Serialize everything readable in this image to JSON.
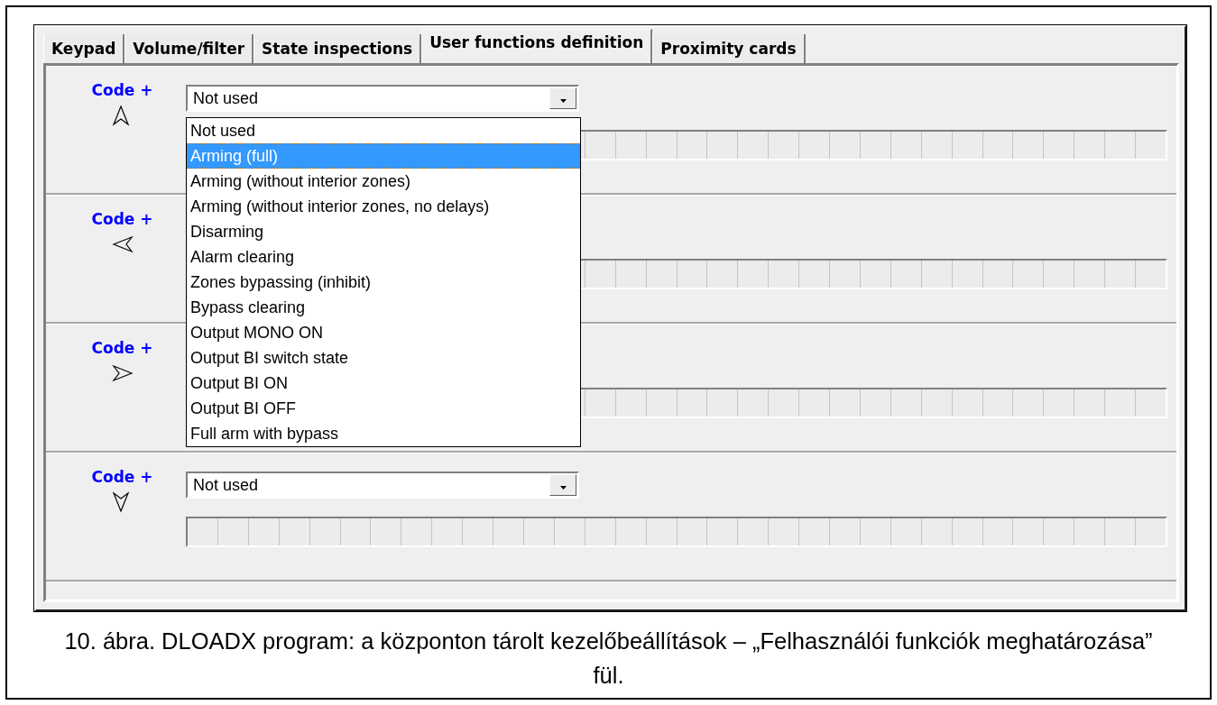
{
  "tabs": [
    {
      "label": "Keypad",
      "selected": false
    },
    {
      "label": "Volume/filter",
      "selected": false
    },
    {
      "label": "State inspections",
      "selected": false
    },
    {
      "label": "User functions definition",
      "selected": true
    },
    {
      "label": "Proximity cards",
      "selected": false
    }
  ],
  "functions": [
    {
      "label": "Code +",
      "kind": "up",
      "value": "Not used",
      "open_list": {
        "options": [
          {
            "label": "Not used",
            "selected": false
          },
          {
            "label": "Arming (full)",
            "selected": true
          },
          {
            "label": "Arming (without interior zones)",
            "selected": false
          },
          {
            "label": "Arming (without interior zones, no delays)",
            "selected": false
          },
          {
            "label": "Disarming",
            "selected": false
          },
          {
            "label": "Alarm clearing",
            "selected": false
          },
          {
            "label": "Zones bypassing (inhibit)",
            "selected": false
          },
          {
            "label": "Bypass clearing",
            "selected": false
          },
          {
            "label": "Output MONO ON",
            "selected": false
          },
          {
            "label": "Output BI switch state",
            "selected": false
          },
          {
            "label": "Output BI ON",
            "selected": false
          },
          {
            "label": "Output BI OFF",
            "selected": false
          },
          {
            "label": "Full arm with bypass",
            "selected": false
          }
        ]
      }
    },
    {
      "label": "Code +",
      "kind": "left"
    },
    {
      "label": "Code +",
      "kind": "right"
    },
    {
      "label": "Code +",
      "kind": "down",
      "value": "Not used"
    }
  ],
  "caption": "10. ábra. DLOADX program: a központon tárolt kezelőbeállítások – „Felhasználói funkciók meghatározása” fül."
}
